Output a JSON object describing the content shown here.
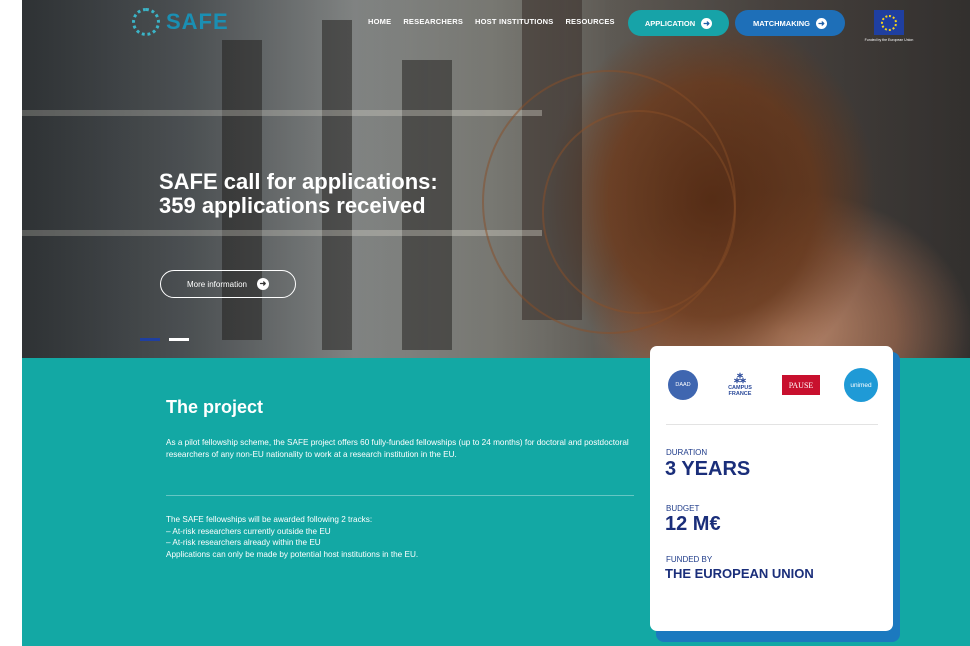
{
  "header": {
    "logo_text": "SAFE",
    "nav": [
      "HOME",
      "RESEARCHERS",
      "HOST INSTITUTIONS",
      "RESOURCES"
    ],
    "application_label": "APPLICATION",
    "matchmaking_label": "MATCHMAKING",
    "eu_caption": "Funded by the European Union"
  },
  "hero": {
    "title": "SAFE call for applications: 359 applications received",
    "more_info_label": "More information"
  },
  "project": {
    "title": "The project",
    "paragraph1": "As a pilot fellowship scheme, the SAFE project offers 60 fully-funded fellowships (up to 24 months) for doctoral and postdoctoral researchers of any non-EU nationality to work at a research institution in the EU.",
    "tracks_intro": "The SAFE fellowships will be awarded following 2 tracks:",
    "track1": "– At-risk researchers currently outside the EU",
    "track2": "– At-risk researchers already within the EU",
    "note": "Applications can only be made by potential host institutions in the EU."
  },
  "card": {
    "partners": {
      "daad": "DAAD",
      "campus_france": "CAMPUS FRANCE",
      "pause": "PAUSE",
      "unimed": "unimed"
    },
    "duration_label": "DURATION",
    "duration_value": "3 YEARS",
    "budget_label": "BUDGET",
    "budget_value": "12 M€",
    "funded_label": "FUNDED BY",
    "funded_value": "THE EUROPEAN UNION"
  },
  "colors": {
    "teal": "#13a8a4",
    "navy": "#1a2e7a",
    "application_btn": "#17a3a8",
    "matchmaking_btn": "#1e6fb8",
    "slider_active": "#1f3fa0"
  },
  "icons": [
    "logo-ring-icon",
    "arrow-right-icon",
    "eu-flag-icon"
  ]
}
